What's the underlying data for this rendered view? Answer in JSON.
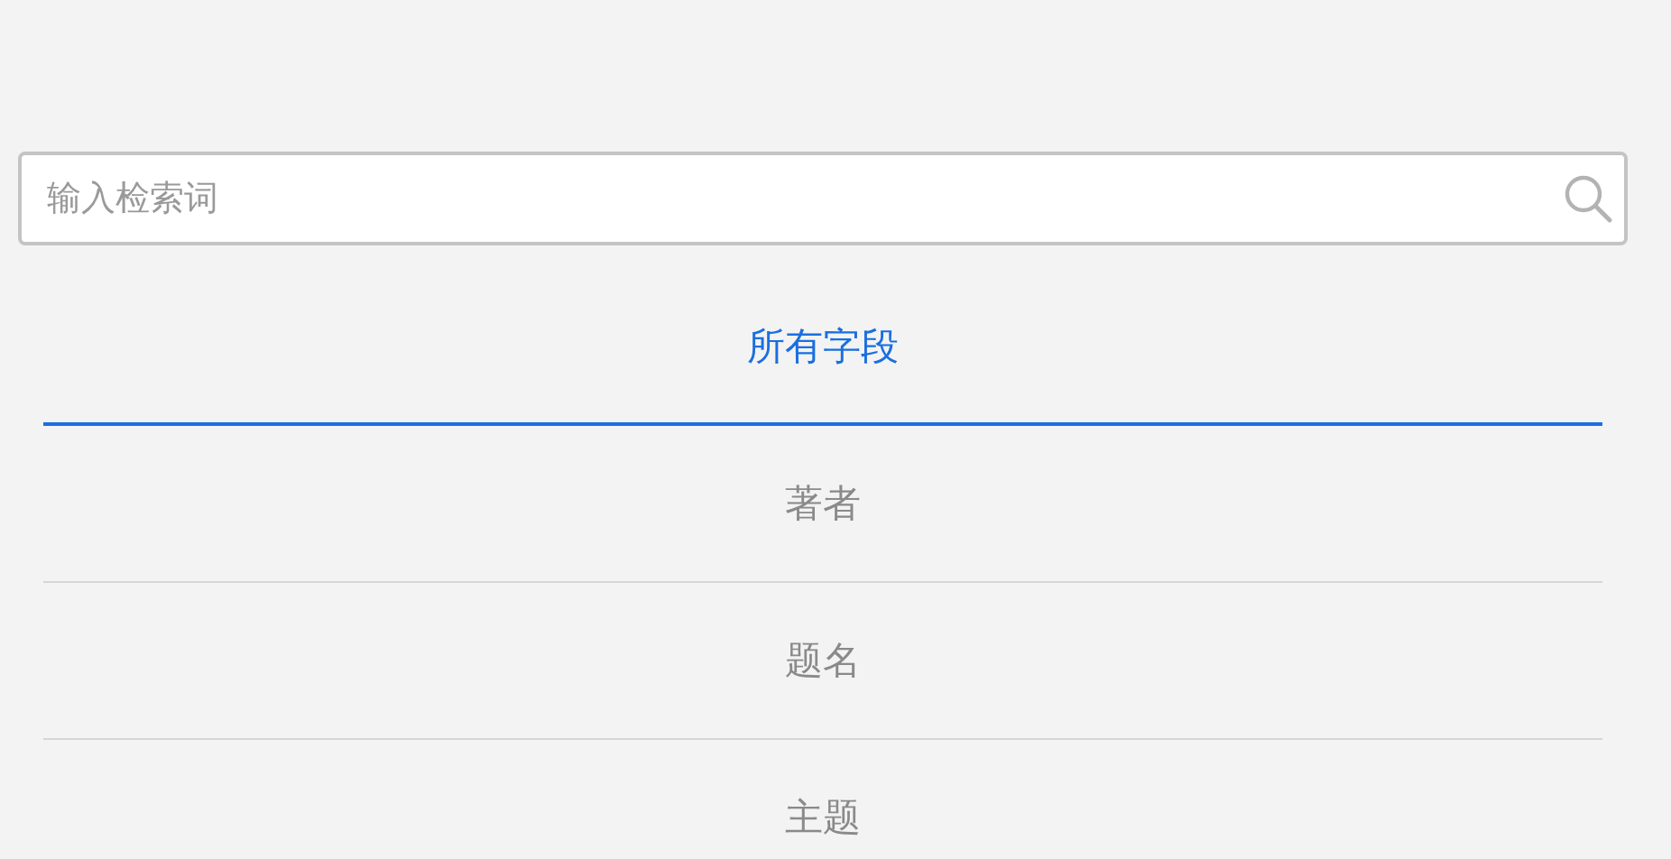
{
  "search": {
    "placeholder": "输入检索词"
  },
  "fields": [
    {
      "label": "所有字段",
      "selected": true
    },
    {
      "label": "著者",
      "selected": false
    },
    {
      "label": "题名",
      "selected": false
    },
    {
      "label": "主题",
      "selected": false
    }
  ]
}
